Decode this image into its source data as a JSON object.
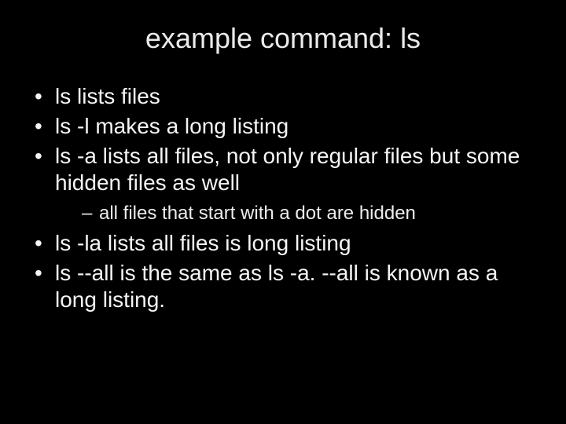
{
  "title": "example command: ls",
  "bullets": {
    "b0": "ls lists files",
    "b1": "ls -l makes a long listing",
    "b2": "ls -a lists all files, not only regular files but some hidden files as well",
    "b2_sub0": "all files that start with a dot are hidden",
    "b3": "ls -la lists all files is long listing",
    "b4": "ls --all is the same as ls -a. --all is known as a long listing."
  }
}
